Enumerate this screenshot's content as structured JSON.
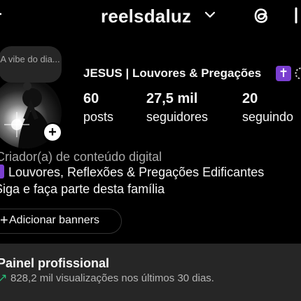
{
  "header": {
    "username": "reelsdaluz",
    "icons": [
      "back-icon",
      "chevron-down-icon",
      "threads-icon",
      "menu-icon"
    ]
  },
  "note": {
    "text": "A vibe do dia..."
  },
  "profile": {
    "display_name": "JESUS | Louvores & Pregações",
    "cross_emoji": "✝"
  },
  "stats": {
    "posts": {
      "value": "60",
      "label": "posts"
    },
    "followers": {
      "value": "27,5 mil",
      "label": "seguidores"
    },
    "following": {
      "value": "20",
      "label": "seguindo"
    }
  },
  "bio": {
    "category": "Criador(a) de conteúdo digital",
    "line1": "Louvores, Reflexões & Pregações Edificantes",
    "line2": "Siga e faça parte desta família"
  },
  "banner": {
    "plus": "+",
    "label": "Adicionar banners"
  },
  "professional_panel": {
    "title": "Painel profissional",
    "arrow": "↗",
    "subtitle": "828,2 mil visualizações nos últimos 30 dias."
  },
  "colors": {
    "background": "#000000",
    "panel": "#262626",
    "accent_purple": "#7a3fd0",
    "trend_green": "#27c07a"
  }
}
